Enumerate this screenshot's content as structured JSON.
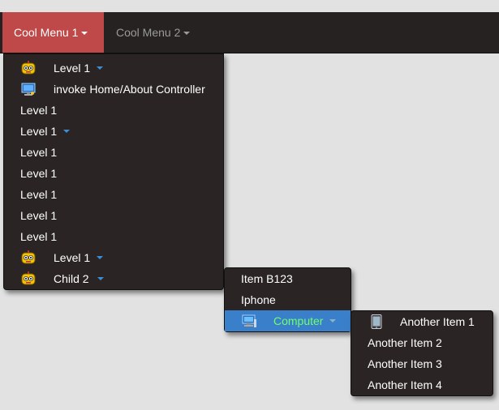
{
  "navbar": {
    "menu1": "Cool Menu 1",
    "menu2": "Cool Menu 2"
  },
  "menu1_items": [
    {
      "label": "Level 1",
      "icon": "robot-icon",
      "submenu": true
    },
    {
      "label": "invoke Home/About Controller",
      "icon": "monitor-icon",
      "submenu": false
    },
    {
      "label": "Level 1",
      "icon": null,
      "submenu": false
    },
    {
      "label": "Level 1",
      "icon": null,
      "submenu": true
    },
    {
      "label": "Level 1",
      "icon": null,
      "submenu": false
    },
    {
      "label": "Level 1",
      "icon": null,
      "submenu": false
    },
    {
      "label": "Level 1",
      "icon": null,
      "submenu": false
    },
    {
      "label": "Level 1",
      "icon": null,
      "submenu": false
    },
    {
      "label": "Level 1",
      "icon": null,
      "submenu": false
    },
    {
      "label": "Level 1",
      "icon": "robot-icon",
      "submenu": true
    },
    {
      "label": "Child 2",
      "icon": "robot-icon",
      "submenu": true
    }
  ],
  "menu2_items": [
    {
      "label": "Item B123"
    },
    {
      "label": "Iphone"
    },
    {
      "label": "Computer"
    }
  ],
  "menu3_items": [
    {
      "label": "Another Item 1"
    },
    {
      "label": "Another Item 2"
    },
    {
      "label": "Another Item 3"
    },
    {
      "label": "Another Item 4"
    }
  ],
  "colors": {
    "navbar_bg": "#262222",
    "active_menu": "#bf4848",
    "menu_bg": "#2a2424",
    "highlight": "#3a7fc9",
    "highlight_text": "#6dff6d"
  }
}
